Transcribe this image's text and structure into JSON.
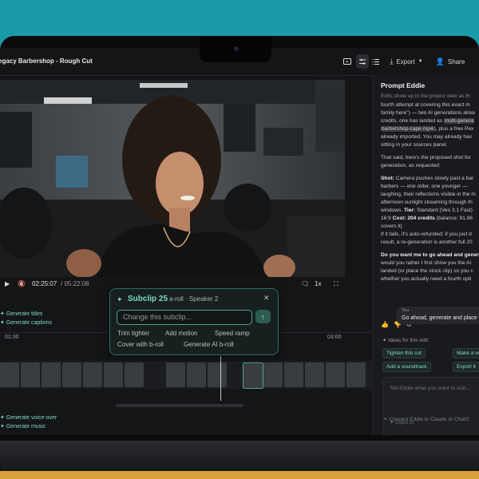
{
  "project": {
    "title": "egacy Barbershop - Rough Cut"
  },
  "toolbar": {
    "export_label": "Export",
    "share_label": "Share"
  },
  "player": {
    "current_time": "02:25:07",
    "total_time": "/ 05:22:08",
    "speed": "1x"
  },
  "timeline": {
    "generate_titles": "Generate titles",
    "generate_captions": "Generate captions",
    "generate_voiceover": "Generate voice-over",
    "generate_music": "Generate music",
    "ruler_left": "01:30",
    "ruler_right": "03:00"
  },
  "popup": {
    "title": "Subclip 25",
    "subtitle": "a-roll · Speaker 2",
    "input_placeholder": "Change this subclip...",
    "options": [
      "Trim tighter",
      "Add motion",
      "Speed ramp",
      "Cover with b-roll",
      "Generate AI b-roll"
    ]
  },
  "sidebar": {
    "title": "Prompt Eddie",
    "line1": "Edits show up in the project view as th",
    "line2": "fourth attempt at covering this exact m",
    "line3": "family here\") — two AI generations alrea",
    "line4_a": "credits, one has landed as ",
    "line4_b": "multi-genera",
    "line5_a": "barbershop-cape.mp4",
    "line5_b": "), plus a free Pex",
    "line6": "already imported. You may already hav",
    "line7": "sitting in your sources panel.",
    "line8": "That said, here's the proposed shot for",
    "line9": "generation, as requested:",
    "line10_b": "Shot:",
    "line10": " Camera pushes slowly past a bar",
    "line11": "barbers — one older, one younger —",
    "line12": "laughing, their reflections visible in the m",
    "line13": "afternoon sunlight streaming through th",
    "line14_a": "windows. ",
    "line14_b": "Tier:",
    "line14_c": " Standard (Veo 3.1 Fast) ·",
    "line15_a": "16:9 ",
    "line15_b": "Cost: 204 credits",
    "line15_c": " (balance: 91,96",
    "line16": "covers it)",
    "line17": "If it fails, it's auto-refunded; if you just d",
    "line18": "result, a re-generation is another full 20",
    "line19": "Do you want me to go ahead and gener",
    "line20": "would you rather I first show you the AI",
    "line21": "landed (or place the stock clip) so you c",
    "line22": "whether you actually need a fourth opti",
    "user_label": "You",
    "user_msg": "Go ahead, generate and place",
    "ideas_label": "Ideas for this edit:",
    "chips": [
      "Tighten this cut",
      "Make a ve",
      "Add a soundtrack",
      "Export it"
    ],
    "input_placeholder": "Tell Eddie what you want to edit...",
    "open_in": "Open in",
    "connect": "Connect Eddie to Claude or ChatG"
  },
  "colors": {
    "accent": "#7fd9c3",
    "background": "#141517",
    "brand_teal": "#1b9aa9"
  }
}
